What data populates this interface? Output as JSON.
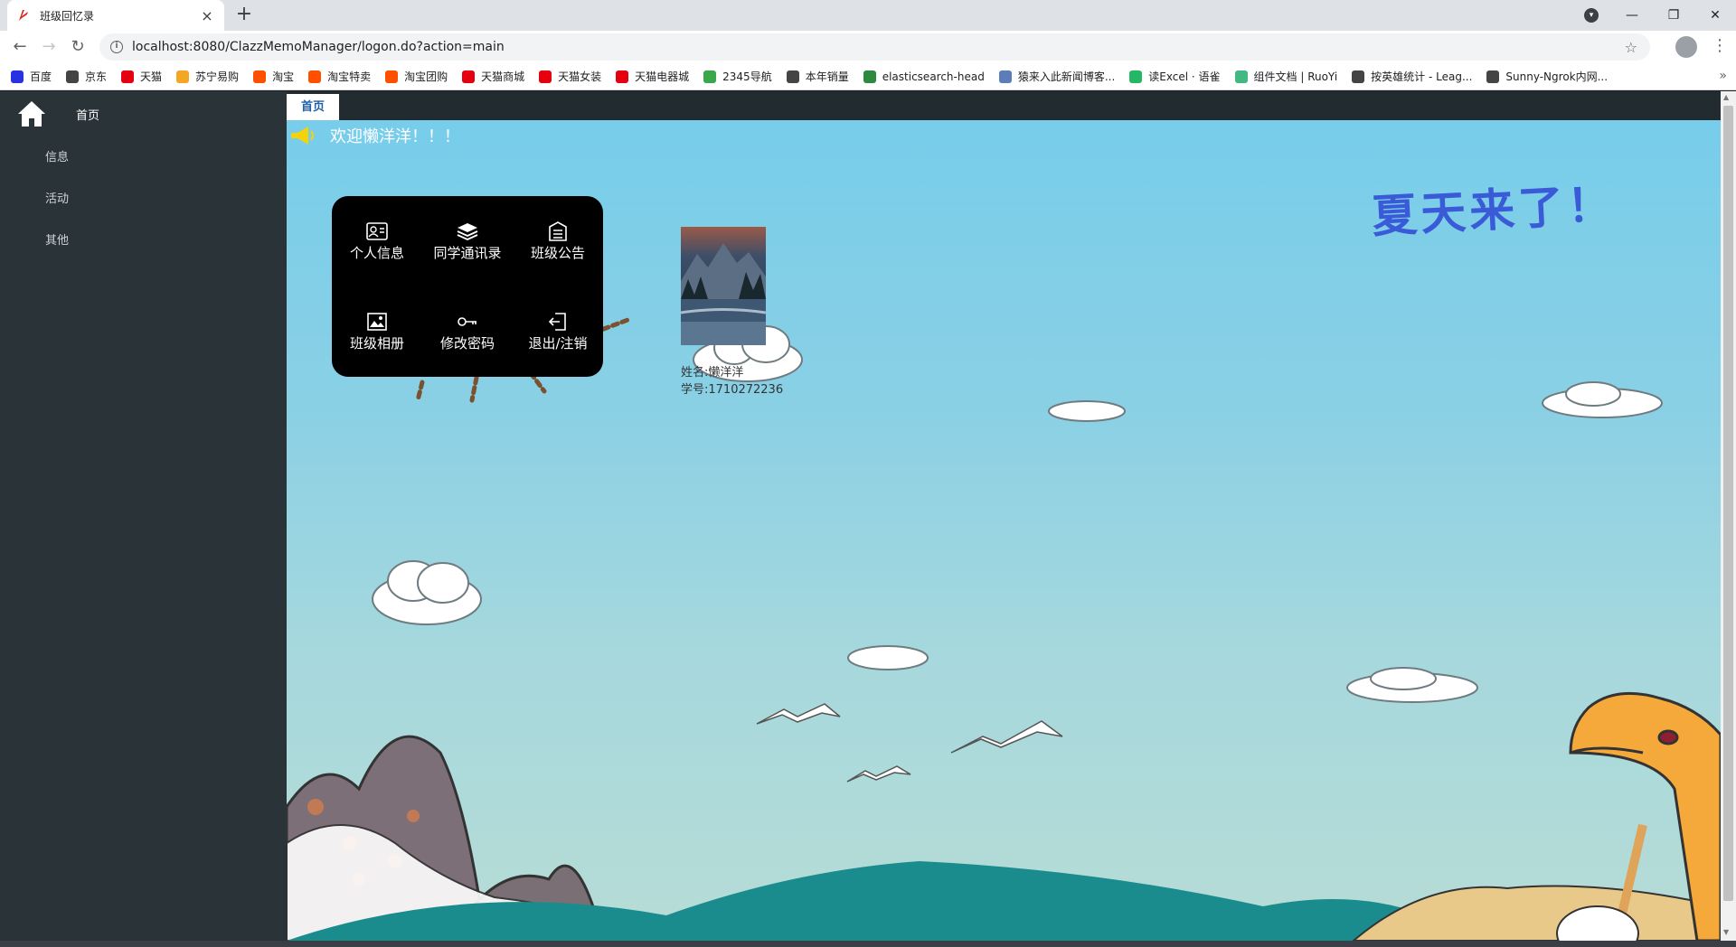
{
  "browser": {
    "tab_title": "班级回忆录",
    "new_tab_label": "+",
    "url": "localhost:8080/ClazzMemoManager/logon.do?action=main",
    "bookmarks": [
      {
        "label": "百度",
        "icon": "paw-icon",
        "color": "#2932e1"
      },
      {
        "label": "京东",
        "icon": "globe-icon",
        "color": "#444444"
      },
      {
        "label": "天猫",
        "icon": "tmall-icon",
        "color": "#e4000f"
      },
      {
        "label": "苏宁易购",
        "icon": "suning-icon",
        "color": "#f5a623"
      },
      {
        "label": "淘宝",
        "icon": "taobao-icon",
        "color": "#ff5000"
      },
      {
        "label": "淘宝特卖",
        "icon": "taobao-icon",
        "color": "#ff5000"
      },
      {
        "label": "淘宝团购",
        "icon": "taobao-icon",
        "color": "#ff5000"
      },
      {
        "label": "天猫商城",
        "icon": "tmall-icon",
        "color": "#e4000f"
      },
      {
        "label": "天猫女装",
        "icon": "tmall-icon",
        "color": "#e4000f"
      },
      {
        "label": "天猫电器城",
        "icon": "tmall-icon",
        "color": "#e4000f"
      },
      {
        "label": "2345导航",
        "icon": "2345-icon",
        "color": "#3aa84a"
      },
      {
        "label": "本年销量",
        "icon": "globe-icon",
        "color": "#444444"
      },
      {
        "label": "elasticsearch-head",
        "icon": "elastic-icon",
        "color": "#2b8a3e"
      },
      {
        "label": "猿来入此新闻博客...",
        "icon": "bird-icon",
        "color": "#5b7db8"
      },
      {
        "label": "读Excel · 语雀",
        "icon": "yuque-icon",
        "color": "#25b864"
      },
      {
        "label": "组件文档 | RuoYi",
        "icon": "leaf-icon",
        "color": "#42b983"
      },
      {
        "label": "按英雄统计 - Leag...",
        "icon": "globe-icon",
        "color": "#444444"
      },
      {
        "label": "Sunny-Ngrok内网...",
        "icon": "globe-icon",
        "color": "#444444"
      }
    ],
    "more_bookmarks": "»"
  },
  "sidebar": {
    "home_label": "首页",
    "items": [
      {
        "label": "信息"
      },
      {
        "label": "活动"
      },
      {
        "label": "其他"
      }
    ]
  },
  "content": {
    "active_tab": "首页",
    "welcome": "欢迎懒洋洋！！！",
    "banner": "夏天来了！",
    "menu": [
      {
        "label": "个人信息",
        "icon": "id-card-icon"
      },
      {
        "label": "同学通讯录",
        "icon": "layers-icon"
      },
      {
        "label": "班级公告",
        "icon": "notice-icon"
      },
      {
        "label": "班级相册",
        "icon": "image-icon"
      },
      {
        "label": "修改密码",
        "icon": "key-icon"
      },
      {
        "label": "退出/注销",
        "icon": "logout-icon"
      }
    ],
    "profile": {
      "name_line": "姓名:懒洋洋",
      "id_line": "学号:1710272236"
    }
  },
  "colors": {
    "sidebar_bg": "#2a3338",
    "tabbar_bg": "#222b30",
    "active_tab_text": "#1f5fa8",
    "sky_top": "#77cdea",
    "menu_panel": "#000000"
  }
}
